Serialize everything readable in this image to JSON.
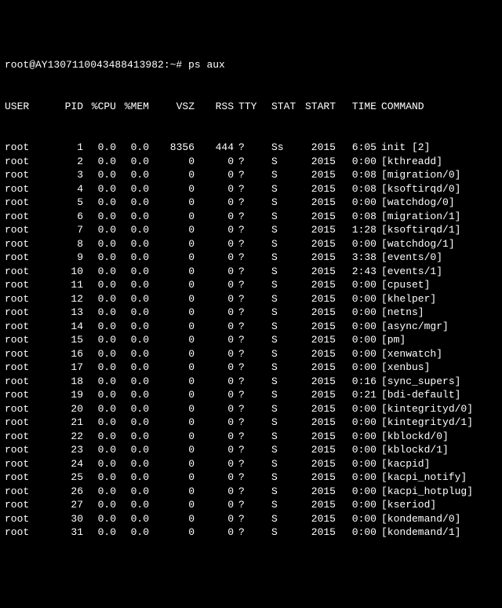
{
  "prompt": "root@AY1307110043488413982:~# ps aux",
  "headers": {
    "user": "USER",
    "pid": "PID",
    "cpu": "%CPU",
    "mem": "%MEM",
    "vsz": "VSZ",
    "rss": "RSS",
    "tty": "TTY",
    "stat": "STAT",
    "start": "START",
    "time": "TIME",
    "command": "COMMAND"
  },
  "rows": [
    {
      "user": "root",
      "pid": "1",
      "cpu": "0.0",
      "mem": "0.0",
      "vsz": "8356",
      "rss": "444",
      "tty": "?",
      "stat": "Ss",
      "start": "2015",
      "time": "6:05",
      "command": "init [2]"
    },
    {
      "user": "root",
      "pid": "2",
      "cpu": "0.0",
      "mem": "0.0",
      "vsz": "0",
      "rss": "0",
      "tty": "?",
      "stat": "S",
      "start": "2015",
      "time": "0:00",
      "command": "[kthreadd]"
    },
    {
      "user": "root",
      "pid": "3",
      "cpu": "0.0",
      "mem": "0.0",
      "vsz": "0",
      "rss": "0",
      "tty": "?",
      "stat": "S",
      "start": "2015",
      "time": "0:08",
      "command": "[migration/0]"
    },
    {
      "user": "root",
      "pid": "4",
      "cpu": "0.0",
      "mem": "0.0",
      "vsz": "0",
      "rss": "0",
      "tty": "?",
      "stat": "S",
      "start": "2015",
      "time": "0:08",
      "command": "[ksoftirqd/0]"
    },
    {
      "user": "root",
      "pid": "5",
      "cpu": "0.0",
      "mem": "0.0",
      "vsz": "0",
      "rss": "0",
      "tty": "?",
      "stat": "S",
      "start": "2015",
      "time": "0:00",
      "command": "[watchdog/0]"
    },
    {
      "user": "root",
      "pid": "6",
      "cpu": "0.0",
      "mem": "0.0",
      "vsz": "0",
      "rss": "0",
      "tty": "?",
      "stat": "S",
      "start": "2015",
      "time": "0:08",
      "command": "[migration/1]"
    },
    {
      "user": "root",
      "pid": "7",
      "cpu": "0.0",
      "mem": "0.0",
      "vsz": "0",
      "rss": "0",
      "tty": "?",
      "stat": "S",
      "start": "2015",
      "time": "1:28",
      "command": "[ksoftirqd/1]"
    },
    {
      "user": "root",
      "pid": "8",
      "cpu": "0.0",
      "mem": "0.0",
      "vsz": "0",
      "rss": "0",
      "tty": "?",
      "stat": "S",
      "start": "2015",
      "time": "0:00",
      "command": "[watchdog/1]"
    },
    {
      "user": "root",
      "pid": "9",
      "cpu": "0.0",
      "mem": "0.0",
      "vsz": "0",
      "rss": "0",
      "tty": "?",
      "stat": "S",
      "start": "2015",
      "time": "3:38",
      "command": "[events/0]"
    },
    {
      "user": "root",
      "pid": "10",
      "cpu": "0.0",
      "mem": "0.0",
      "vsz": "0",
      "rss": "0",
      "tty": "?",
      "stat": "S",
      "start": "2015",
      "time": "2:43",
      "command": "[events/1]"
    },
    {
      "user": "root",
      "pid": "11",
      "cpu": "0.0",
      "mem": "0.0",
      "vsz": "0",
      "rss": "0",
      "tty": "?",
      "stat": "S",
      "start": "2015",
      "time": "0:00",
      "command": "[cpuset]"
    },
    {
      "user": "root",
      "pid": "12",
      "cpu": "0.0",
      "mem": "0.0",
      "vsz": "0",
      "rss": "0",
      "tty": "?",
      "stat": "S",
      "start": "2015",
      "time": "0:00",
      "command": "[khelper]"
    },
    {
      "user": "root",
      "pid": "13",
      "cpu": "0.0",
      "mem": "0.0",
      "vsz": "0",
      "rss": "0",
      "tty": "?",
      "stat": "S",
      "start": "2015",
      "time": "0:00",
      "command": "[netns]"
    },
    {
      "user": "root",
      "pid": "14",
      "cpu": "0.0",
      "mem": "0.0",
      "vsz": "0",
      "rss": "0",
      "tty": "?",
      "stat": "S",
      "start": "2015",
      "time": "0:00",
      "command": "[async/mgr]"
    },
    {
      "user": "root",
      "pid": "15",
      "cpu": "0.0",
      "mem": "0.0",
      "vsz": "0",
      "rss": "0",
      "tty": "?",
      "stat": "S",
      "start": "2015",
      "time": "0:00",
      "command": "[pm]"
    },
    {
      "user": "root",
      "pid": "16",
      "cpu": "0.0",
      "mem": "0.0",
      "vsz": "0",
      "rss": "0",
      "tty": "?",
      "stat": "S",
      "start": "2015",
      "time": "0:00",
      "command": "[xenwatch]"
    },
    {
      "user": "root",
      "pid": "17",
      "cpu": "0.0",
      "mem": "0.0",
      "vsz": "0",
      "rss": "0",
      "tty": "?",
      "stat": "S",
      "start": "2015",
      "time": "0:00",
      "command": "[xenbus]"
    },
    {
      "user": "root",
      "pid": "18",
      "cpu": "0.0",
      "mem": "0.0",
      "vsz": "0",
      "rss": "0",
      "tty": "?",
      "stat": "S",
      "start": "2015",
      "time": "0:16",
      "command": "[sync_supers]"
    },
    {
      "user": "root",
      "pid": "19",
      "cpu": "0.0",
      "mem": "0.0",
      "vsz": "0",
      "rss": "0",
      "tty": "?",
      "stat": "S",
      "start": "2015",
      "time": "0:21",
      "command": "[bdi-default]"
    },
    {
      "user": "root",
      "pid": "20",
      "cpu": "0.0",
      "mem": "0.0",
      "vsz": "0",
      "rss": "0",
      "tty": "?",
      "stat": "S",
      "start": "2015",
      "time": "0:00",
      "command": "[kintegrityd/0]"
    },
    {
      "user": "root",
      "pid": "21",
      "cpu": "0.0",
      "mem": "0.0",
      "vsz": "0",
      "rss": "0",
      "tty": "?",
      "stat": "S",
      "start": "2015",
      "time": "0:00",
      "command": "[kintegrityd/1]"
    },
    {
      "user": "root",
      "pid": "22",
      "cpu": "0.0",
      "mem": "0.0",
      "vsz": "0",
      "rss": "0",
      "tty": "?",
      "stat": "S",
      "start": "2015",
      "time": "0:00",
      "command": "[kblockd/0]"
    },
    {
      "user": "root",
      "pid": "23",
      "cpu": "0.0",
      "mem": "0.0",
      "vsz": "0",
      "rss": "0",
      "tty": "?",
      "stat": "S",
      "start": "2015",
      "time": "0:00",
      "command": "[kblockd/1]"
    },
    {
      "user": "root",
      "pid": "24",
      "cpu": "0.0",
      "mem": "0.0",
      "vsz": "0",
      "rss": "0",
      "tty": "?",
      "stat": "S",
      "start": "2015",
      "time": "0:00",
      "command": "[kacpid]"
    },
    {
      "user": "root",
      "pid": "25",
      "cpu": "0.0",
      "mem": "0.0",
      "vsz": "0",
      "rss": "0",
      "tty": "?",
      "stat": "S",
      "start": "2015",
      "time": "0:00",
      "command": "[kacpi_notify]"
    },
    {
      "user": "root",
      "pid": "26",
      "cpu": "0.0",
      "mem": "0.0",
      "vsz": "0",
      "rss": "0",
      "tty": "?",
      "stat": "S",
      "start": "2015",
      "time": "0:00",
      "command": "[kacpi_hotplug]"
    },
    {
      "user": "root",
      "pid": "27",
      "cpu": "0.0",
      "mem": "0.0",
      "vsz": "0",
      "rss": "0",
      "tty": "?",
      "stat": "S",
      "start": "2015",
      "time": "0:00",
      "command": "[kseriod]"
    },
    {
      "user": "root",
      "pid": "30",
      "cpu": "0.0",
      "mem": "0.0",
      "vsz": "0",
      "rss": "0",
      "tty": "?",
      "stat": "S",
      "start": "2015",
      "time": "0:00",
      "command": "[kondemand/0]"
    },
    {
      "user": "root",
      "pid": "31",
      "cpu": "0.0",
      "mem": "0.0",
      "vsz": "0",
      "rss": "0",
      "tty": "?",
      "stat": "S",
      "start": "2015",
      "time": "0:00",
      "command": "[kondemand/1]"
    }
  ]
}
